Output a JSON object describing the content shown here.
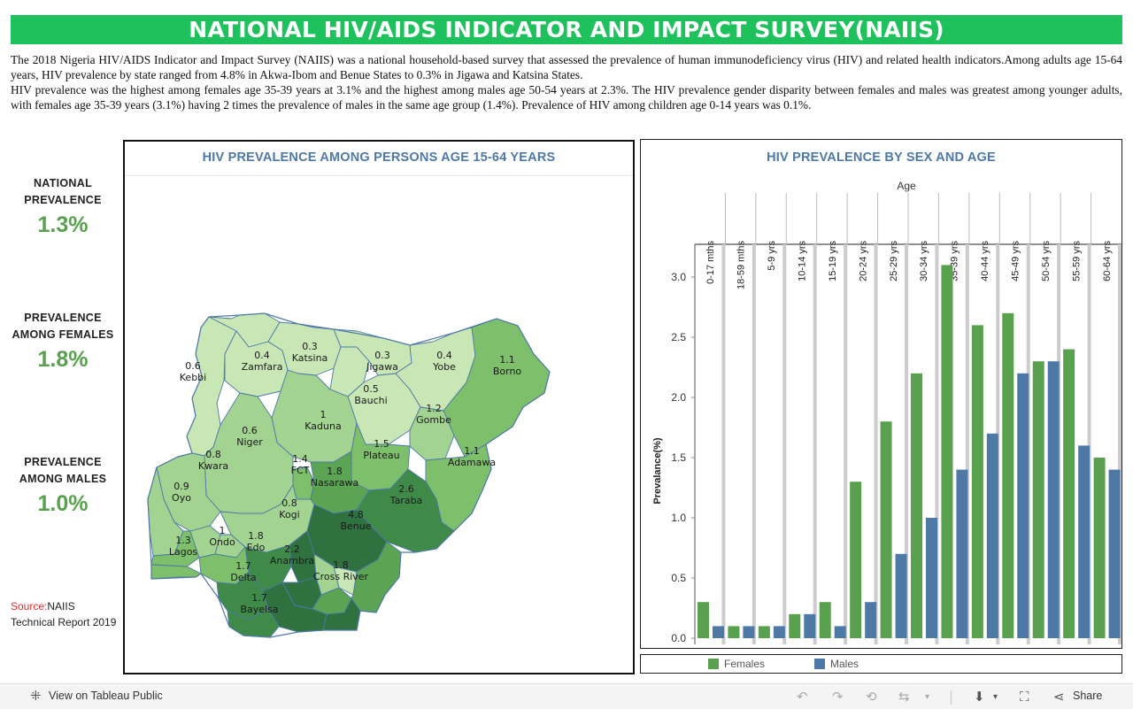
{
  "header": {
    "title": "NATIONAL HIV/AIDS INDICATOR AND IMPACT SURVEY(NAIIS)"
  },
  "intro": {
    "p1": "The 2018 Nigeria HIV/AIDS Indicator and Impact Survey (NAIIS) was a national household-based survey that assessed the prevalence of human immunodeficiency virus (HIV) and related health indicators.Among adults age 15-64 years, HIV prevalence by state ranged from 4.8% in Akwa-Ibom and Benue States to 0.3% in Jigawa and Katsina States.",
    "p2": "HIV prevalence was the highest among females age 35-39 years at 3.1% and the highest among males age 50-54 years at 2.3%. The HIV prevalence gender disparity between females and males was greatest among younger adults, with females age 35-39 years (3.1%) having 2 times the prevalence of males in the same age group (1.4%). Prevalence of HIV among children age 0-14 years was 0.1%."
  },
  "kpis": {
    "national": {
      "label_line1": "NATIONAL",
      "label_line2": "PREVALENCE",
      "value": "1.3%"
    },
    "females": {
      "label_line1": "PREVALENCE",
      "label_line2": "AMONG  FEMALES",
      "value": "1.8%"
    },
    "males": {
      "label_line1": "PREVALENCE",
      "label_line2": "AMONG  MALES",
      "value": "1.0%"
    }
  },
  "source": {
    "key": "Source:",
    "text": "NAIIS Technical Report 2019"
  },
  "map": {
    "title": "HIV PREVALENCE AMONG PERSONS AGE 15-64 YEARS",
    "colors": {
      "very_light": "#c9e6b5",
      "light": "#a3d390",
      "medium": "#7dbf6a",
      "medium_dark": "#5aa453",
      "dark": "#3f8a49",
      "darkest": "#2f7240",
      "border": "#4e79a7"
    },
    "states": [
      {
        "name": "Kebbi",
        "value": "0.6"
      },
      {
        "name": "Zamfara",
        "value": "0.4"
      },
      {
        "name": "Katsina",
        "value": "0.3"
      },
      {
        "name": "Jigawa",
        "value": "0.3"
      },
      {
        "name": "Yobe",
        "value": "0.4"
      },
      {
        "name": "Borno",
        "value": "1.1"
      },
      {
        "name": "Bauchi",
        "value": "0.5"
      },
      {
        "name": "Gombe",
        "value": "1.2"
      },
      {
        "name": "Kaduna",
        "value": "1"
      },
      {
        "name": "Niger",
        "value": "0.6"
      },
      {
        "name": "Plateau",
        "value": "1.5"
      },
      {
        "name": "Adamawa",
        "value": "1.1"
      },
      {
        "name": "Kwara",
        "value": "0.8"
      },
      {
        "name": "FCT",
        "value": "1.4"
      },
      {
        "name": "Nasarawa",
        "value": "1.8"
      },
      {
        "name": "Taraba",
        "value": "2.6"
      },
      {
        "name": "Oyo",
        "value": "0.9"
      },
      {
        "name": "Kogi",
        "value": "0.8"
      },
      {
        "name": "Benue",
        "value": "4.8"
      },
      {
        "name": "Ondo",
        "value": "1"
      },
      {
        "name": "Edo",
        "value": "1.8"
      },
      {
        "name": "Lagos",
        "value": "1.3"
      },
      {
        "name": "Anambra",
        "value": "2.2"
      },
      {
        "name": "Delta",
        "value": "1.7"
      },
      {
        "name": "Cross River",
        "value": "1.8"
      },
      {
        "name": "Bayelsa",
        "value": "1.7"
      }
    ]
  },
  "chart_data": {
    "type": "bar",
    "title": "HIV PREVALENCE BY SEX AND AGE",
    "column_header": "Age",
    "ylabel": "Prevalance(%)",
    "ylim": [
      0,
      3.25
    ],
    "yticks": [
      0.0,
      0.5,
      1.0,
      1.5,
      2.0,
      2.5,
      3.0
    ],
    "categories": [
      "0-17 mths",
      "18-59 mths",
      "5-9 yrs",
      "10-14 yrs",
      "15-19 yrs",
      "20-24 yrs",
      "25-29 yrs",
      "30-34 yrs",
      "35-39 yrs",
      "40-44 yrs",
      "45-49 yrs",
      "50-54 yrs",
      "55-59 yrs",
      "60-64 yrs"
    ],
    "series": [
      {
        "name": "Females",
        "color": "#59a14f",
        "values": [
          0.3,
          0.1,
          0.1,
          0.2,
          0.3,
          1.3,
          1.8,
          2.2,
          3.1,
          2.6,
          2.7,
          2.3,
          2.4,
          1.5
        ]
      },
      {
        "name": "Males",
        "color": "#4e79a7",
        "values": [
          0.1,
          0.1,
          0.1,
          0.2,
          0.1,
          0.3,
          0.7,
          1.0,
          1.4,
          1.7,
          2.2,
          2.3,
          1.6,
          1.4
        ]
      }
    ],
    "legend_position": "bottom",
    "grid": false
  },
  "toolbar": {
    "view_label": "View on Tableau Public",
    "share_label": "Share",
    "icons": [
      "tableau-logo-icon",
      "undo-icon",
      "redo-icon",
      "revert-icon",
      "refresh-icon",
      "download-icon",
      "fullscreen-icon",
      "share-icon"
    ]
  }
}
